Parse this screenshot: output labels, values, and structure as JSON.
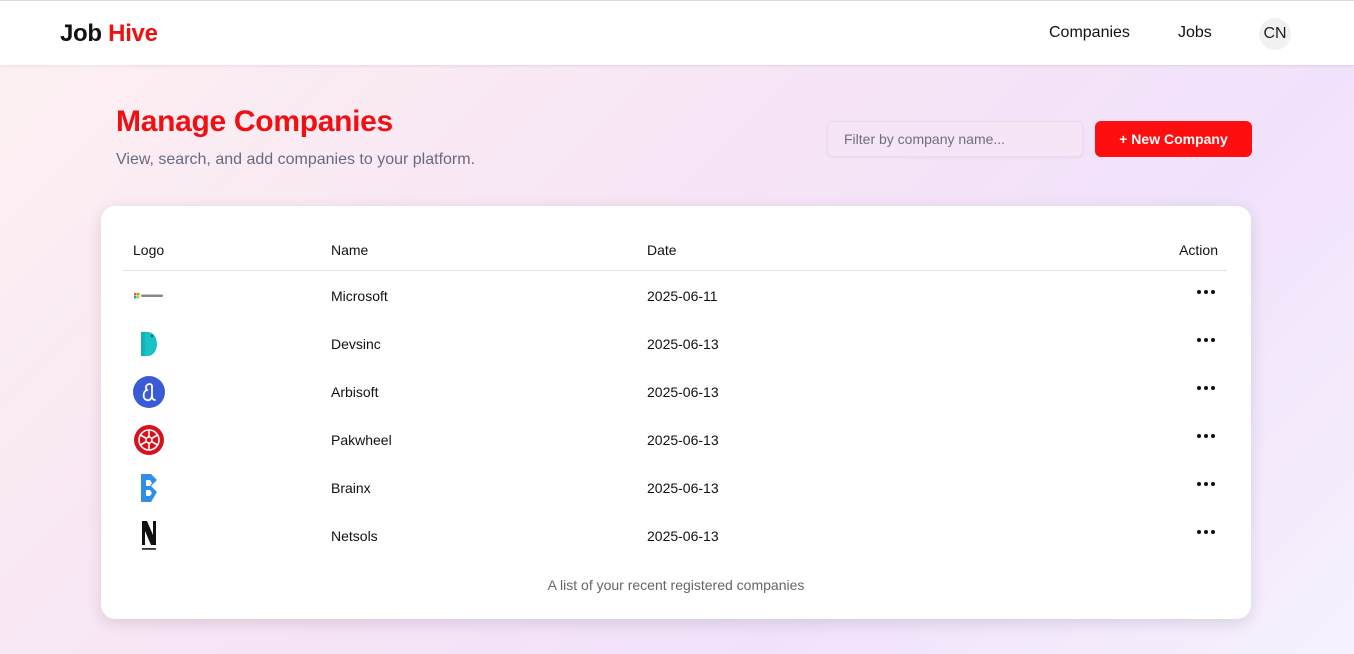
{
  "navbar": {
    "brand_prefix": "Job",
    "brand_suffix": "Hive",
    "links": [
      "Companies",
      "Jobs"
    ],
    "avatar_initials": "CN"
  },
  "header": {
    "title": "Manage Companies",
    "subtitle": "View, search, and add companies to your platform."
  },
  "search": {
    "placeholder": "Filter by company name...",
    "value": ""
  },
  "new_button_label": "+ New Company",
  "table": {
    "columns": [
      "Logo",
      "Name",
      "Date",
      "Action"
    ],
    "rows": [
      {
        "logo": "microsoft-logo",
        "name": "Microsoft",
        "date": "2025-06-11"
      },
      {
        "logo": "devsinc-logo",
        "name": "Devsinc",
        "date": "2025-06-13"
      },
      {
        "logo": "arbisoft-logo",
        "name": "Arbisoft",
        "date": "2025-06-13"
      },
      {
        "logo": "pakwheel-logo",
        "name": "Pakwheel",
        "date": "2025-06-13"
      },
      {
        "logo": "brainx-logo",
        "name": "Brainx",
        "date": "2025-06-13"
      },
      {
        "logo": "netsols-logo",
        "name": "Netsols",
        "date": "2025-06-13"
      }
    ],
    "caption": "A list of your recent registered companies"
  },
  "colors": {
    "accent": "#f10f12",
    "button": "#fe0e0e",
    "subtitle": "#676a82"
  }
}
